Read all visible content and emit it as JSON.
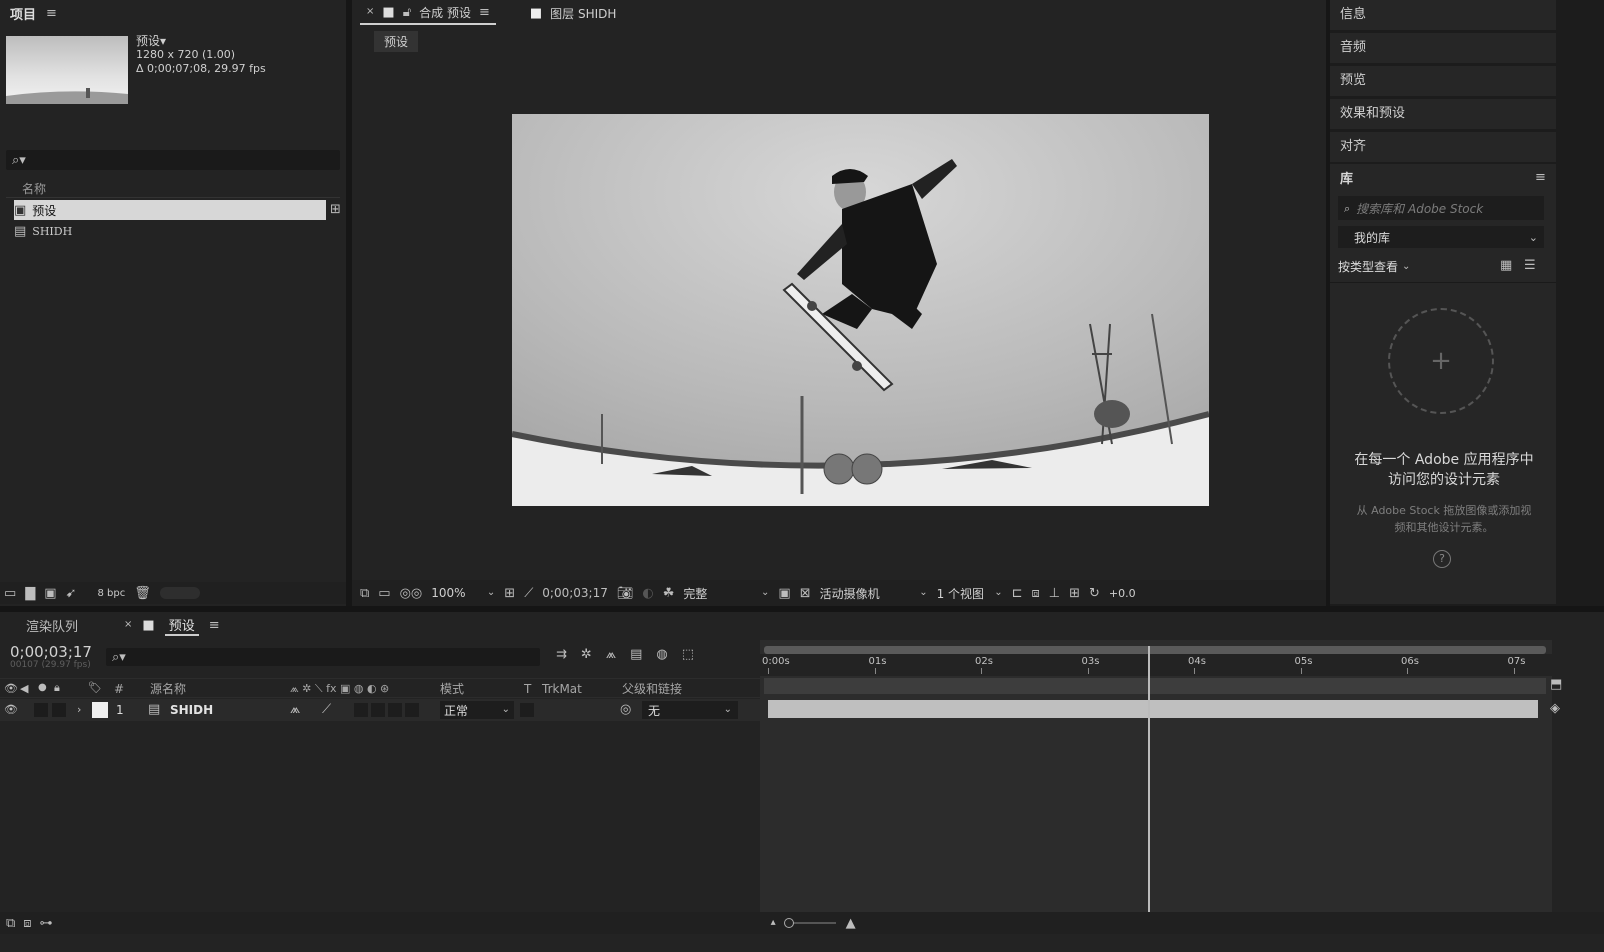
{
  "project": {
    "title": "项目",
    "thumb_name": "预设▾",
    "thumb_resolution": "1280 x 720 (1.00)",
    "thumb_duration": "Δ 0;00;07;08, 29.97 fps",
    "col_name": "名称",
    "items": [
      {
        "label": "预设",
        "type": "composition",
        "selected": true
      },
      {
        "label": "SHIDH",
        "type": "footage",
        "selected": false
      }
    ],
    "bpc": "8 bpc"
  },
  "comp": {
    "tab_label": "合成 预设",
    "layer_tab_label": "图层 SHIDH",
    "breadcrumb": "预设",
    "footer": {
      "zoom": "100%",
      "timecode": "0;00;03;17",
      "resolution": "完整",
      "camera": "活动摄像机",
      "views": "1 个视图",
      "exposure": "+0.0"
    }
  },
  "right_panels": {
    "items": [
      "信息",
      "音频",
      "预览",
      "效果和预设",
      "对齐"
    ],
    "library": {
      "title": "库",
      "search_placeholder": "搜索库和 Adobe Stock",
      "my_library": "我的库",
      "view_by": "按类型查看",
      "promo_title": "在每一个 Adobe 应用程序中访问您的设计元素",
      "promo_sub": "从 Adobe Stock 拖放图像或添加视频和其他设计元素。"
    }
  },
  "timeline": {
    "render_queue_tab": "渲染队列",
    "comp_tab": "预设",
    "timecode": "0;00;03;17",
    "frame_info": "00107 (29.97 fps)",
    "columns": {
      "hash": "#",
      "source_name": "源名称",
      "mode": "模式",
      "t": "T",
      "trkmat": "TrkMat",
      "parent": "父级和链接"
    },
    "layers": [
      {
        "index": "1",
        "name": "SHIDH",
        "mode": "正常",
        "parent": "无"
      }
    ],
    "ruler": [
      "0:00s",
      "01s",
      "02s",
      "03s",
      "04s",
      "05s",
      "06s",
      "07s"
    ],
    "playhead_seconds": 3.57
  },
  "colors": {
    "background": "#1c1c1c",
    "panel": "#232323",
    "selection": "#d7d7d7"
  }
}
